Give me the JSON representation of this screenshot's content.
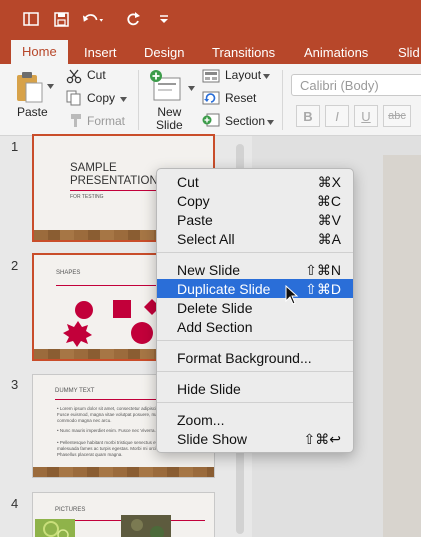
{
  "tabs": {
    "home": "Home",
    "insert": "Insert",
    "design": "Design",
    "transitions": "Transitions",
    "animations": "Animations",
    "slideshow_partial": "Slid"
  },
  "ribbon": {
    "paste": "Paste",
    "cut": "Cut",
    "copy": "Copy",
    "format": "Format",
    "new_slide": "New\nSlide",
    "layout": "Layout",
    "reset": "Reset",
    "section": "Section",
    "font_name": "Calibri (Body)",
    "bold": "B",
    "italic": "I",
    "underline": "U",
    "strikethrough": "abc"
  },
  "slides": {
    "numbers": [
      "1",
      "2",
      "3",
      "4"
    ],
    "s1_title": "SAMPLE\nPRESENTATION",
    "s1_sub": "FOR TESTING",
    "s2_title": "SHAPES",
    "s3_title": "DUMMY TEXT",
    "s3_b1": "• Lorem ipsum dolor sit amet, consectetur adipiscing elit. Maecenas\n   Fusce euismod, magna vitae volutpat posuere, massa mi\n   commodo magna nec arcu.",
    "s3_b2": "• Nunc mauris imperdiet enim. Fusce nec Viverra.",
    "s3_b3": "• Pellentesque habitant morbi tristique senectus et netus et\n   malesuada fames ac turpis egestas. Morbi mi orci.\n   Phasellus placerat quam magna.",
    "s4_title": "PICTURES"
  },
  "context_menu": {
    "items": [
      {
        "label": "Cut",
        "shortcut": "⌘X"
      },
      {
        "label": "Copy",
        "shortcut": "⌘C"
      },
      {
        "label": "Paste",
        "shortcut": "⌘V"
      },
      {
        "label": "Select All",
        "shortcut": "⌘A"
      },
      {
        "label": "New Slide",
        "shortcut": "⇧⌘N"
      },
      {
        "label": "Duplicate Slide",
        "shortcut": "⇧⌘D"
      },
      {
        "label": "Delete Slide",
        "shortcut": ""
      },
      {
        "label": "Add Section",
        "shortcut": ""
      },
      {
        "label": "Format Background...",
        "shortcut": ""
      },
      {
        "label": "Hide Slide",
        "shortcut": ""
      },
      {
        "label": "Zoom...",
        "shortcut": ""
      },
      {
        "label": "Slide Show",
        "shortcut": "⇧⌘↩"
      }
    ],
    "highlighted": "Duplicate Slide"
  },
  "colors": {
    "brand": "#b7472a",
    "highlight": "#2a6ed8",
    "accent_shape": "#c2003a"
  },
  "icons": [
    "sidebar-toggle-icon",
    "save-icon",
    "undo-icon",
    "redo-icon",
    "customize-icon",
    "paste-icon",
    "scissors-icon",
    "copy-icon",
    "format-painter-icon",
    "new-slide-icon",
    "layout-icon",
    "reset-icon",
    "section-icon",
    "mouse-pointer-icon"
  ]
}
